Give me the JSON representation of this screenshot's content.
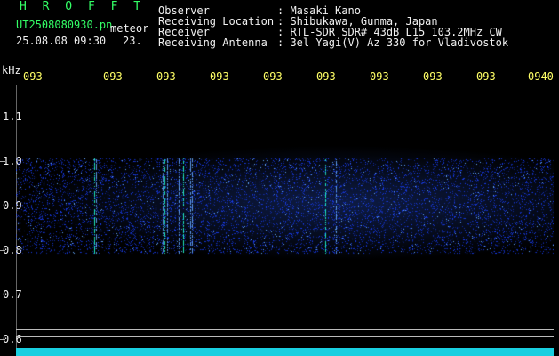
{
  "header": {
    "brand": "H R O F F T",
    "filename": "UT2508080930.pn",
    "filename_suffix": "meteor",
    "timestamp": "25.08.08 09:30",
    "stamp_number": "23.",
    "info": [
      {
        "label": "Observer",
        "value": ": Masaki Kano"
      },
      {
        "label": "Receiving Location",
        "value": ": Shibukawa, Gunma, Japan"
      },
      {
        "label": "Receiver",
        "value": ": RTL-SDR SDR# 43dB L15 103.2MHz CW"
      },
      {
        "label": "Receiving Antenna",
        "value": ": 3el Yagi(V) Az 330 for Vladivostok"
      }
    ]
  },
  "axis": {
    "unit": "kHz",
    "y_ticks": [
      "1.1",
      "1.0",
      "0.9",
      "0.8",
      "0.7",
      "0.6"
    ],
    "x_ticks": [
      "093",
      "093",
      "093",
      "093",
      "093",
      "093",
      "093",
      "093",
      "093",
      "0940"
    ]
  },
  "colors": {
    "noise": "#1a40ff",
    "noise_bright": "#66aaff",
    "meteor": "#22ffcc",
    "bar": "#19cfe0",
    "label_green": "#33ff66",
    "label_yellow": "#ffff66"
  }
}
